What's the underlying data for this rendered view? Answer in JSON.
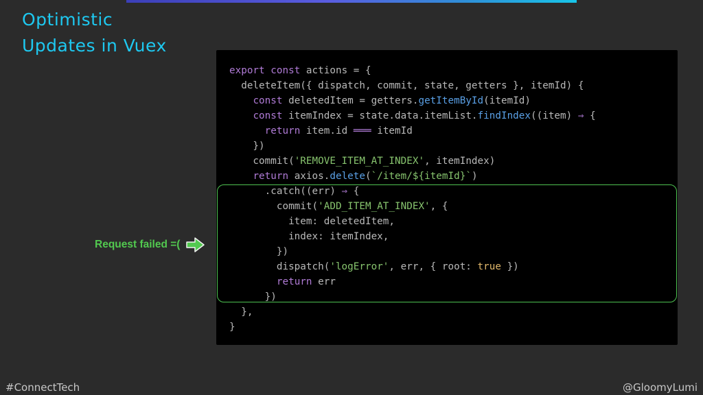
{
  "slide": {
    "title_line1": "Optimistic",
    "title_line2": "Updates in Vuex"
  },
  "code_lines": [
    "export const actions = {",
    "  deleteItem({ dispatch, commit, state, getters }, itemId) {",
    "    const deletedItem = getters.getItemById(itemId)",
    "    const itemIndex = state.data.itemList.findIndex((item) ⇒ {",
    "      return item.id ═══ itemId",
    "    })",
    "    commit('REMOVE_ITEM_AT_INDEX', itemIndex)",
    "    return axios.delete(`/item/${itemId}`)",
    "      .catch((err) ⇒ {",
    "        commit('ADD_ITEM_AT_INDEX', {",
    "          item: deletedItem,",
    "          index: itemIndex,",
    "        })",
    "        dispatch('logError', err, { root: true })",
    "        return err",
    "      })",
    "  },",
    "}"
  ],
  "callout": {
    "label": "Request failed =(",
    "icon": "right-arrow-icon",
    "color": "#52c94f"
  },
  "footer": {
    "left": "#ConnectTech",
    "right": "@GloomyLumi"
  },
  "colors": {
    "background": "#2b2b2b",
    "title": "#1ec8f0",
    "code_background": "#000000",
    "highlight_border": "#4fc452"
  }
}
